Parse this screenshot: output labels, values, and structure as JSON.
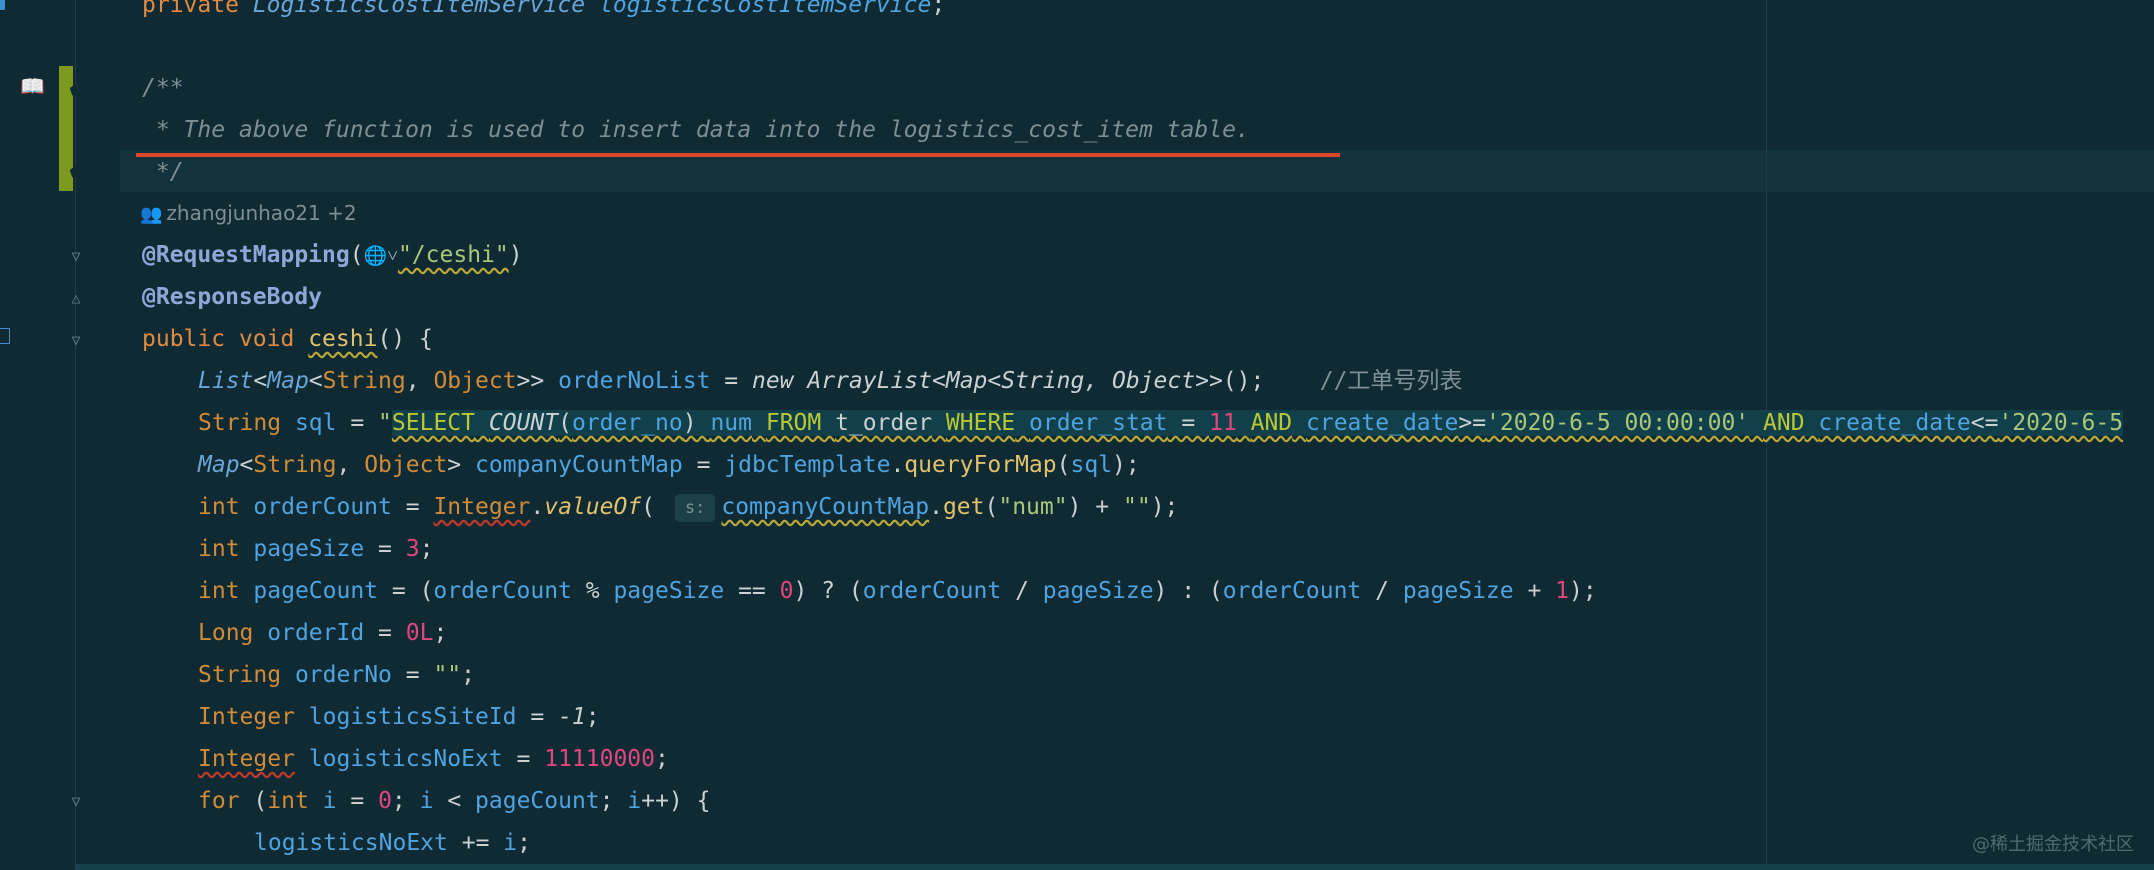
{
  "editor": {
    "comment_open": "/**",
    "comment_body": " * The above function is used to insert data into the logistics_cost_item table.",
    "comment_close": " */",
    "author_info": "zhangjunhao21 +2",
    "watermark": "@稀土掘金技术社区"
  },
  "colors": {
    "background": "#0f2a33",
    "keyword": "#e08a42",
    "identifier": "#4fa3e0",
    "number": "#e0467f",
    "string": "#a8c77a",
    "annotation": "#8ea7d8",
    "vcs_modified": "#7c9b1e",
    "error_underline": "#e0462e"
  },
  "icons": [
    "bookmark-icon",
    "fold-icon",
    "people-icon",
    "globe-icon"
  ],
  "code": {
    "l0": {
      "kw": "private",
      "ty": "LogisticsCostItemService",
      "id": "logisticsCostItemService",
      "end": ";"
    },
    "l1": {
      "an": "@RequestMapping",
      "p1": "(",
      "str": "\"/ceshi\"",
      "p2": ")"
    },
    "l2": {
      "an": "@ResponseBody"
    },
    "l3": {
      "kw1": "public",
      "kw2": "void",
      "fn": "ceshi",
      "rest": "() {"
    },
    "l4": {
      "t1": "List",
      "t2": "Map",
      "t3": "String",
      "t4": "Object",
      "id": "orderNoList",
      "kw": "new",
      "ctor": "ArrayList<Map<String, Object>>",
      "end": "();",
      "comment": "//工单号列表"
    },
    "l5": {
      "ty": "String",
      "id": "sql",
      "q": "\"",
      "s1": "SELECT",
      "fn": "COUNT",
      "s2": "order_no",
      "s3": "num",
      "s4": "FROM",
      "s5": "t_order",
      "s6": "WHERE",
      "s7": "order_stat",
      "s8": "11",
      "s9": "AND",
      "s10": "create_date",
      "s11": "'2020-6-5 00:00:00'",
      "s12": "AND",
      "s13": "create_date",
      "s14": "'2020-6-5"
    },
    "l6": {
      "t1": "Map",
      "t2": "String",
      "t3": "Object",
      "id": "companyCountMap",
      "obj": "jdbcTemplate",
      "fn": "queryForMap",
      "arg": "sql",
      "end": ");"
    },
    "l7": {
      "kw": "int",
      "id": "orderCount",
      "cls": "Integer",
      "fn": "valueOf",
      "hint": "s:",
      "obj": "companyCountMap",
      "fn2": "get",
      "s1": "\"num\"",
      "s2": "\"\"",
      "end": ");"
    },
    "l8": {
      "kw": "int",
      "id": "pageSize",
      "num": "3"
    },
    "l9": {
      "kw": "int",
      "id": "pageCount",
      "a": "orderCount",
      "b": "pageSize",
      "n0": "0",
      "c": "orderCount",
      "d": "pageSize",
      "e": "orderCount",
      "f": "pageSize",
      "n1": "1"
    },
    "l10": {
      "kw": "Long",
      "id": "orderId",
      "num": "0L"
    },
    "l11": {
      "kw": "String",
      "id": "orderNo",
      "str": "\"\""
    },
    "l12": {
      "kw": "Integer",
      "id": "logisticsSiteId",
      "num": "-1"
    },
    "l13": {
      "kw": "Integer",
      "id": "logisticsNoExt",
      "num": "11110000"
    },
    "l14": {
      "kw": "for",
      "kw2": "int",
      "i1": "i",
      "n0": "0",
      "i2": "i",
      "lim": "pageCount",
      "i3": "i"
    },
    "l15": {
      "id": "logisticsNoExt",
      "op": "+=",
      "i": "i"
    }
  }
}
